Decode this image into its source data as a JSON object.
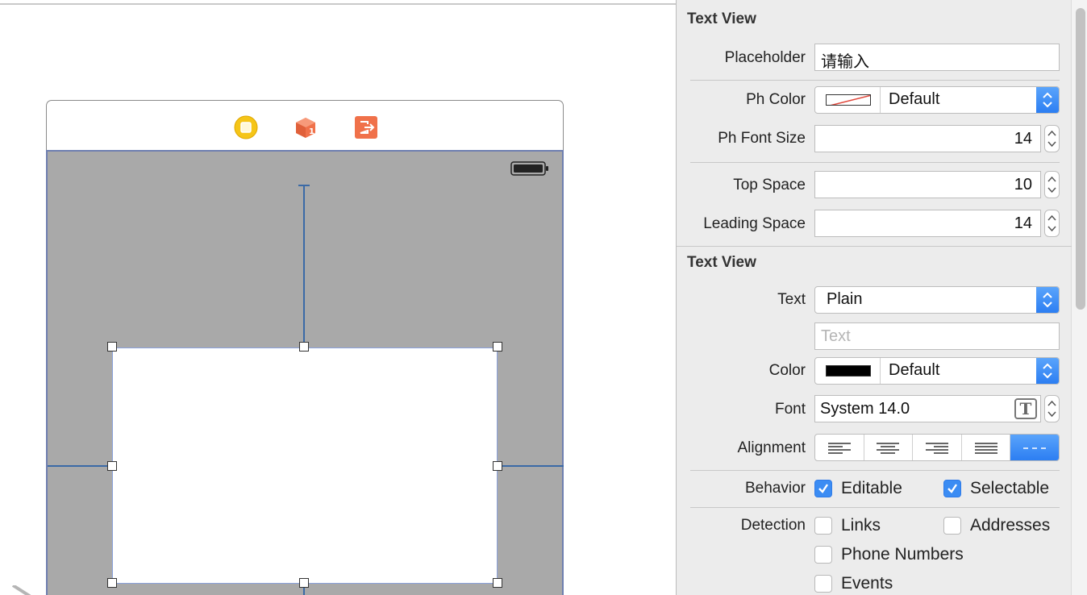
{
  "canvas": {
    "dock_icons": [
      "view-controller-icon",
      "first-responder-icon",
      "exit-icon"
    ],
    "battery_icon": "battery-icon"
  },
  "inspector": {
    "section1": {
      "title": "Text View",
      "placeholder": {
        "label": "Placeholder",
        "value": "请输入"
      },
      "ph_color": {
        "label": "Ph Color",
        "value": "Default"
      },
      "ph_font_size": {
        "label": "Ph Font Size",
        "value": "14"
      },
      "top_space": {
        "label": "Top Space",
        "value": "10"
      },
      "leading_space": {
        "label": "Leading Space",
        "value": "14"
      }
    },
    "section2": {
      "title": "Text View",
      "text": {
        "label": "Text",
        "value": "Plain",
        "field_placeholder": "Text"
      },
      "color": {
        "label": "Color",
        "value": "Default",
        "swatch": "#000000"
      },
      "font": {
        "label": "Font",
        "value": "System 14.0"
      },
      "alignment": {
        "label": "Alignment",
        "options": [
          "left",
          "center",
          "right",
          "justified",
          "natural"
        ],
        "selected": "natural"
      },
      "behavior": {
        "label": "Behavior",
        "editable": {
          "label": "Editable",
          "checked": true
        },
        "selectable": {
          "label": "Selectable",
          "checked": true
        }
      },
      "detection": {
        "label": "Detection",
        "links": {
          "label": "Links",
          "checked": false
        },
        "addresses": {
          "label": "Addresses",
          "checked": false
        },
        "phone_numbers": {
          "label": "Phone Numbers",
          "checked": false
        },
        "events": {
          "label": "Events",
          "checked": false
        }
      }
    }
  },
  "colors": {
    "accent": "#2c7ef2",
    "canvas_view_bg": "#a9a9a9",
    "constraint": "#3b6aa6"
  }
}
